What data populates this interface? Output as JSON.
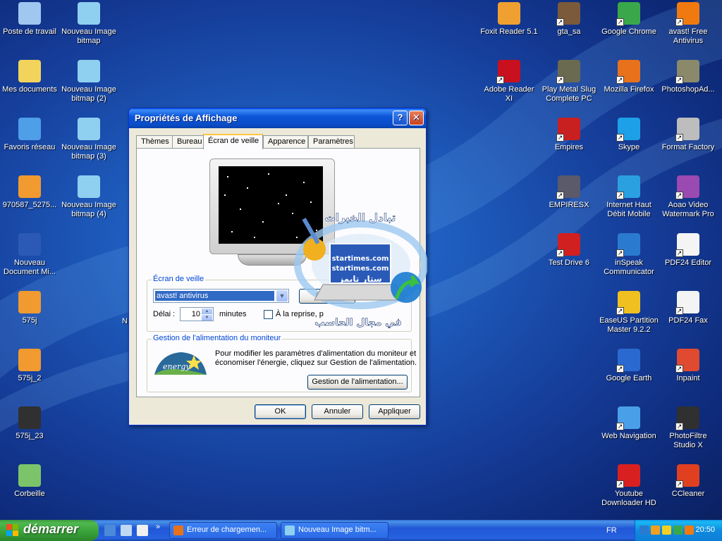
{
  "desktop_icons_left": [
    {
      "label": "Poste de travail",
      "icon": "my-computer-icon",
      "color": "#9fc7f0"
    },
    {
      "label": "Mes documents",
      "icon": "my-documents-icon",
      "color": "#f2d35c"
    },
    {
      "label": "Favoris réseau",
      "icon": "network-places-icon",
      "color": "#4f9ee8"
    },
    {
      "label": "970587_5275...",
      "icon": "image-file-icon",
      "color": "#f09a30"
    },
    {
      "label": "Nouveau Document Mi...",
      "icon": "word-document-icon",
      "color": "#2b59b5"
    },
    {
      "label": "575j",
      "icon": "image-file-icon",
      "color": "#f09a30"
    },
    {
      "label": "575j_2",
      "icon": "image-file-icon",
      "color": "#f09a30"
    },
    {
      "label": "575j_23",
      "icon": "pfi-file-icon",
      "color": "#303030"
    },
    {
      "label": "Corbeille",
      "icon": "recycle-bin-icon",
      "color": "#7cc46a"
    }
  ],
  "desktop_icons_col2": [
    {
      "label": "Nouveau Image bitmap",
      "icon": "paint-bitmap-icon",
      "color": "#8fd0f0"
    },
    {
      "label": "Nouveau Image bitmap (2)",
      "icon": "paint-bitmap-icon",
      "color": "#8fd0f0"
    },
    {
      "label": "Nouveau Image bitmap (3)",
      "icon": "paint-bitmap-icon",
      "color": "#8fd0f0"
    },
    {
      "label": "Nouveau Image bitmap (4)",
      "icon": "paint-bitmap-icon",
      "color": "#8fd0f0"
    }
  ],
  "desktop_icons_right": [
    {
      "label": "Foxit Reader 5.1",
      "icon": "foxit-reader-icon",
      "color": "#f0a030"
    },
    {
      "label": "gta_sa",
      "icon": "gta-sa-icon",
      "color": "#7a5a3a"
    },
    {
      "label": "Google Chrome",
      "icon": "chrome-icon",
      "color": "#3aa84a"
    },
    {
      "label": "avast! Free Antivirus",
      "icon": "avast-icon",
      "color": "#f07a10"
    },
    {
      "label": "Adobe Reader XI",
      "icon": "adobe-reader-icon",
      "color": "#c8101e"
    },
    {
      "label": "Play Metal Slug Complete PC",
      "icon": "metal-slug-icon",
      "color": "#6a6a50"
    },
    {
      "label": "Mozilla Firefox",
      "icon": "firefox-icon",
      "color": "#e8711c"
    },
    {
      "label": "PhotoshopAd...",
      "icon": "plugin-icon",
      "color": "#8a8a6a"
    },
    {
      "label": "Empires",
      "icon": "empires-icon",
      "color": "#c82020"
    },
    {
      "label": "Skype",
      "icon": "skype-icon",
      "color": "#1ea0e8"
    },
    {
      "label": "Format Factory",
      "icon": "format-factory-icon",
      "color": "#bdbdbd"
    },
    {
      "label": "EMPIRESX",
      "icon": "empiresx-icon",
      "color": "#5a5a6a"
    },
    {
      "label": "Internet Haut Débit Mobile",
      "icon": "3g-modem-icon",
      "color": "#2aa0e0"
    },
    {
      "label": "Aoao Video Watermark Pro",
      "icon": "video-watermark-icon",
      "color": "#9a4ab0"
    },
    {
      "label": "Test Drive 6",
      "icon": "test-drive-icon",
      "color": "#d02020"
    },
    {
      "label": "inSpeak Communicator",
      "icon": "inspeak-icon",
      "color": "#2a7ad0"
    },
    {
      "label": "PDF24 Editor",
      "icon": "pdf24-sheep-icon",
      "color": "#f4f4f4"
    },
    {
      "label": "EaseUS Partition Master 9.2.2",
      "icon": "easeus-icon",
      "color": "#f0c020"
    },
    {
      "label": "PDF24 Fax",
      "icon": "pdf24-sheep-icon",
      "color": "#f4f4f4"
    },
    {
      "label": "Google Earth",
      "icon": "google-earth-icon",
      "color": "#2a6ad0"
    },
    {
      "label": "Inpaint",
      "icon": "inpaint-icon",
      "color": "#e04a30"
    },
    {
      "label": "Web Navigation",
      "icon": "web-navigation-icon",
      "color": "#4aa0e8"
    },
    {
      "label": "PhotoFiltre Studio X",
      "icon": "photofiltre-icon",
      "color": "#303030"
    },
    {
      "label": "Youtube Downloader HD",
      "icon": "youtube-downloader-icon",
      "color": "#d82020"
    },
    {
      "label": "CCleaner",
      "icon": "ccleaner-icon",
      "color": "#e04020"
    }
  ],
  "hidden_label_fragment": "N",
  "dialog": {
    "title": "Propriétés de Affichage",
    "help_glyph": "?",
    "close_glyph": "✕",
    "tabs": [
      "Thèmes",
      "Bureau",
      "Écran de veille",
      "Apparence",
      "Paramètres"
    ],
    "screensaver": {
      "legend": "Écran de veille",
      "selected": "avast! antivirus",
      "params_button": "Param",
      "delay_label": "Délai :",
      "delay_value": "10",
      "minutes_label": "minutes",
      "resume_label": "À la reprise, p"
    },
    "power": {
      "legend": "Gestion de l'alimentation du moniteur",
      "description_line1": "Pour modifier les paramètres d'alimentation du moniteur et",
      "description_line2": "économiser l'énergie, cliquez sur Gestion de l'alimentation.",
      "button": "Gestion de l'alimentation...",
      "logo_text": "energy"
    },
    "ok": "OK",
    "cancel": "Annuler",
    "apply": "Appliquer"
  },
  "watermark": {
    "top_text": "تبادل الخبرات",
    "url1": "startimes.com",
    "url2": "startimes.com",
    "brand": "ستار تايمز",
    "bottom_text": "في مجال الحاسب"
  },
  "taskbar": {
    "start_label": "démarrer",
    "quicklaunch_more": "»",
    "tasks": [
      {
        "label": "Erreur de chargemen...",
        "icon": "firefox-icon",
        "color": "#e8711c"
      },
      {
        "label": "Nouveau Image bitm...",
        "icon": "paint-icon",
        "color": "#8fd0f0"
      }
    ],
    "language": "FR",
    "time": "20:50"
  },
  "colors": {
    "xp_blue": "#0a4cc6",
    "dialog_bg": "#ece9d8",
    "start_green": "#37a137"
  }
}
